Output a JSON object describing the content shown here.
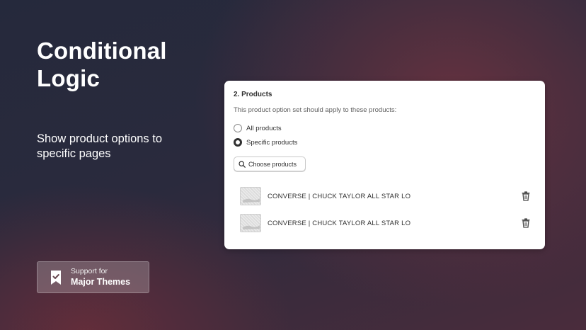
{
  "hero": {
    "title_line1": "Conditional",
    "title_line2": "Logic",
    "subtitle_line1": "Show product options to",
    "subtitle_line2": "specific pages"
  },
  "badge": {
    "small": "Support for",
    "big": "Major Themes",
    "icon": "bookmark-check-icon"
  },
  "card": {
    "title": "2. Products",
    "description": "This product option set should apply to these products:",
    "options": [
      {
        "label": "All products",
        "checked": false
      },
      {
        "label": "Specific products",
        "checked": true
      }
    ],
    "choose_button": "Choose products",
    "products": [
      {
        "name": "CONVERSE | CHUCK TAYLOR ALL STAR LO"
      },
      {
        "name": "CONVERSE | CHUCK TAYLOR ALL STAR LO"
      }
    ]
  },
  "colors": {
    "card_bg": "#ffffff",
    "text": "#303030",
    "muted": "#616161"
  }
}
